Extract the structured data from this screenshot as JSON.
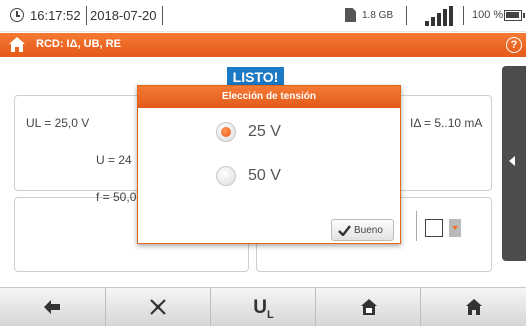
{
  "status": {
    "time": "16:17:52",
    "date": "2018-07-20",
    "memory": "1.8 GB",
    "battery": "100 %"
  },
  "title_bar": {
    "title": "RCD: IΔ, UB, RE"
  },
  "main": {
    "status_badge": "LISTO!",
    "ul_readout": "UL = 25,0 V",
    "ia_readout": "IΔ = 5..10 mA",
    "u_readout": "U = 24",
    "f_readout": "f = 50,0 Hz"
  },
  "modal": {
    "title": "Elección de tensión",
    "options": [
      {
        "label": "25 V",
        "selected": true
      },
      {
        "label": "50 V",
        "selected": false
      }
    ],
    "ok_label": "Bueno"
  },
  "bottom_bar": {
    "ul_button_label": "U",
    "ul_button_sub": "L",
    "buttons": [
      "back-icon",
      "tools-icon",
      "ul-button",
      "save-icon",
      "home-icon"
    ]
  },
  "colors": {
    "accent": "#e8601c",
    "status_badge": "#1c79c3"
  }
}
